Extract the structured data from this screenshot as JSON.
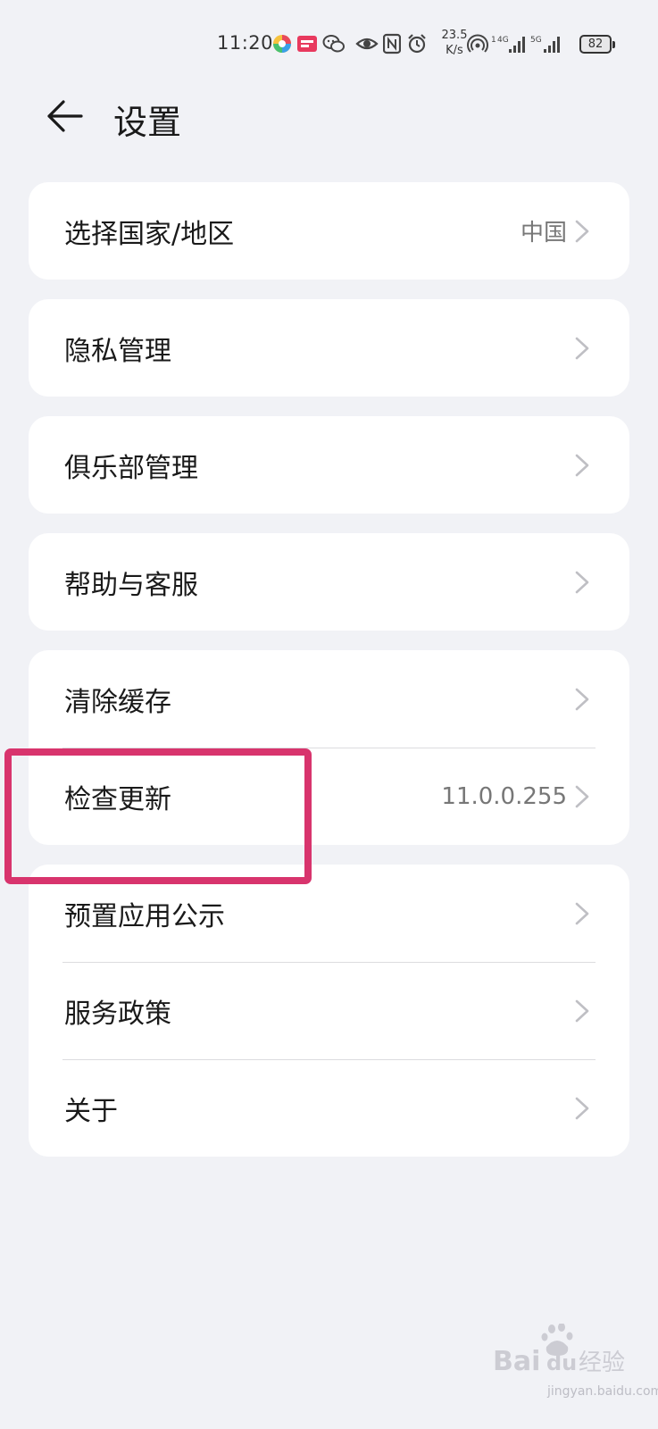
{
  "status_bar": {
    "time": "11:20",
    "net_speed_value": "23.5",
    "net_speed_unit": "K/s",
    "sim1_net": "4G",
    "sim2_net": "5G",
    "battery": "82"
  },
  "header": {
    "title": "设置"
  },
  "groups": [
    {
      "rows": [
        {
          "label": "选择国家/地区",
          "value": "中国"
        }
      ]
    },
    {
      "rows": [
        {
          "label": "隐私管理",
          "value": ""
        }
      ]
    },
    {
      "rows": [
        {
          "label": "俱乐部管理",
          "value": ""
        }
      ]
    },
    {
      "rows": [
        {
          "label": "帮助与客服",
          "value": ""
        }
      ]
    },
    {
      "rows": [
        {
          "label": "清除缓存",
          "value": ""
        },
        {
          "label": "检查更新",
          "value": "11.0.0.255"
        }
      ]
    },
    {
      "rows": [
        {
          "label": "预置应用公示",
          "value": ""
        },
        {
          "label": "服务政策",
          "value": ""
        },
        {
          "label": "关于",
          "value": ""
        }
      ]
    }
  ],
  "watermark": {
    "brand": "Bai",
    "brand2": "du",
    "suffix": "经验",
    "url": "jingyan.baidu.com"
  },
  "colors": {
    "background": "#f1f2f6",
    "card": "#ffffff",
    "highlight": "#d8346d"
  }
}
